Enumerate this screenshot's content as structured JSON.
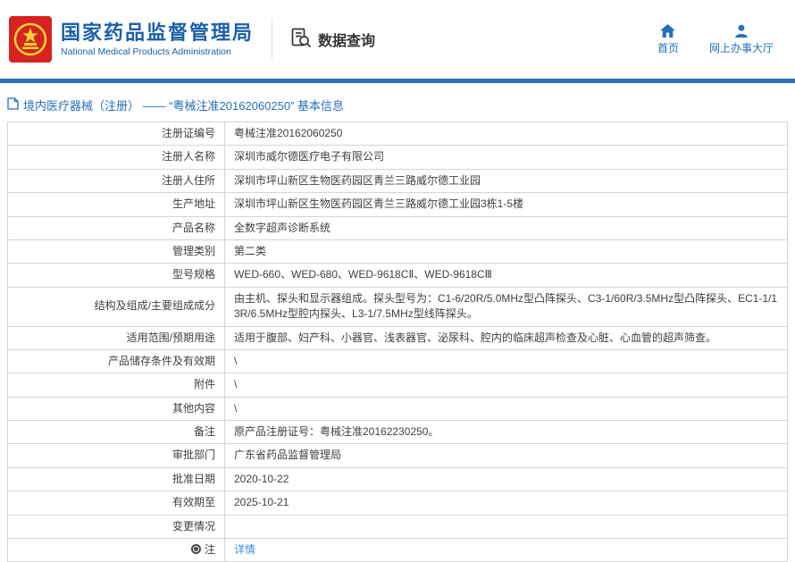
{
  "header": {
    "org_name_cn": "国家药品监督管理局",
    "org_name_en": "National Medical Products Administration",
    "section_title": "数据查询",
    "nav": [
      {
        "label": "首页",
        "icon": "home-icon"
      },
      {
        "label": "网上办事大厅",
        "icon": "person-icon"
      }
    ]
  },
  "colors": {
    "brand_blue": "#1c5fa8",
    "accent_bar": "#2570b7",
    "link_blue": "#3a8fd8",
    "emblem_red": "#d6231f",
    "emblem_yellow": "#f7d633",
    "table_border": "#d4d4d4"
  },
  "breadcrumb": {
    "text": "境内医疗器械（注册） —— “粤械注准20162060250” 基本信息"
  },
  "table": {
    "rows": [
      {
        "label": "注册证编号",
        "value": "粤械注准20162060250"
      },
      {
        "label": "注册人名称",
        "value": "深圳市威尔德医疗电子有限公司"
      },
      {
        "label": "注册人住所",
        "value": "深圳市坪山新区生物医药园区青兰三路威尔德工业园"
      },
      {
        "label": "生产地址",
        "value": "深圳市坪山新区生物医药园区青兰三路威尔德工业园3栋1-5楼"
      },
      {
        "label": "产品名称",
        "value": "全数字超声诊断系统"
      },
      {
        "label": "管理类别",
        "value": "第二类"
      },
      {
        "label": "型号规格",
        "value": "WED-660、WED-680、WED-9618CⅡ、WED-9618CⅢ"
      },
      {
        "label": "结构及组成/主要组成成分",
        "value": "由主机、探头和显示器组成。探头型号为：C1-6/20R/5.0MHz型凸阵探头、C3-1/60R/3.5MHz型凸阵探头、EC1-1/13R/6.5MHz型腔内探头、L3-1/7.5MHz型线阵探头。"
      },
      {
        "label": "适用范围/预期用途",
        "value": "适用于腹部、妇产科、小器官、浅表器官、泌尿科、腔内的临床超声检查及心脏、心血管的超声筛查。"
      },
      {
        "label": "产品储存条件及有效期",
        "value": "\\"
      },
      {
        "label": "附件",
        "value": "\\"
      },
      {
        "label": "其他内容",
        "value": "\\"
      },
      {
        "label": "备注",
        "value": "原产品注册证号：粤械注准20162230250。"
      },
      {
        "label": "审批部门",
        "value": "广东省药品监督管理局"
      },
      {
        "label": "批准日期",
        "value": "2020-10-22"
      },
      {
        "label": "有效期至",
        "value": "2025-10-21"
      },
      {
        "label": "变更情况",
        "value": ""
      },
      {
        "label": "注",
        "value": "详情",
        "is_link": true,
        "label_icon": "note-icon"
      }
    ]
  }
}
